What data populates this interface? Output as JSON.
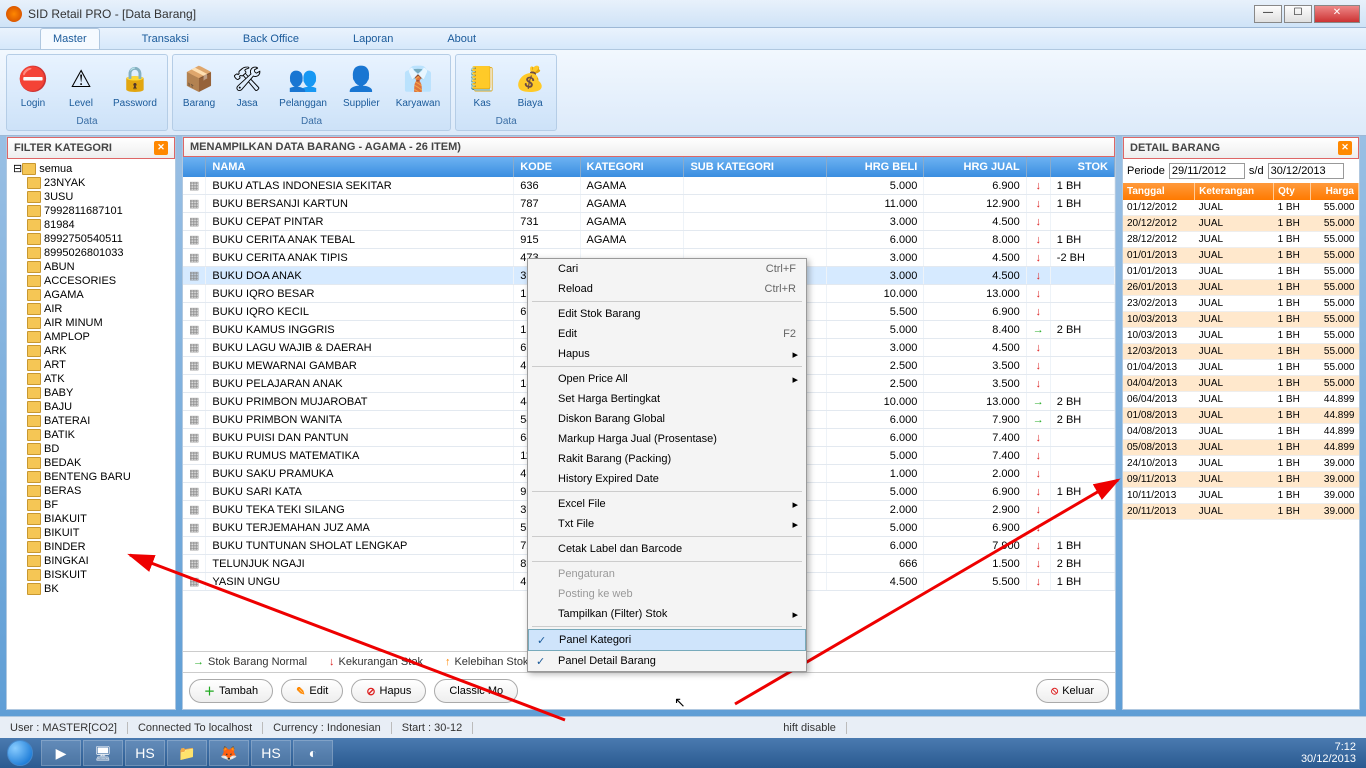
{
  "window": {
    "title": "SID Retail PRO - [Data Barang]"
  },
  "menubar": {
    "tabs": [
      "Master",
      "Transaksi",
      "Back Office",
      "Laporan",
      "About"
    ],
    "active": 0
  },
  "ribbon": {
    "groups": [
      {
        "label": "Data",
        "items": [
          {
            "t": "Login",
            "i": "⛔"
          },
          {
            "t": "Level",
            "i": "⚠"
          },
          {
            "t": "Password",
            "i": "🔒"
          }
        ]
      },
      {
        "label": "Data",
        "items": [
          {
            "t": "Barang",
            "i": "📦"
          },
          {
            "t": "Jasa",
            "i": "🛠"
          },
          {
            "t": "Pelanggan",
            "i": "👥"
          },
          {
            "t": "Supplier",
            "i": "👤"
          },
          {
            "t": "Karyawan",
            "i": "👔"
          }
        ]
      },
      {
        "label": "Data",
        "items": [
          {
            "t": "Kas",
            "i": "📒"
          },
          {
            "t": "Biaya",
            "i": "💰"
          }
        ]
      }
    ]
  },
  "filter": {
    "title": "FILTER KATEGORI",
    "root": "semua",
    "nodes": [
      "23NYAK",
      "3USU",
      "7992811687101",
      "81984",
      "8992750540511",
      "8995026801033",
      "ABUN",
      "ACCESORIES",
      "AGAMA",
      "AIR",
      "AIR MINUM",
      "AMPLOP",
      "ARK",
      "ART",
      "ATK",
      "BABY",
      "BAJU",
      "BATERAI",
      "BATIK",
      "BD",
      "BEDAK",
      "BENTENG BARU",
      "BERAS",
      "BF",
      "BIAKUIT",
      "BIKUIT",
      "BINDER",
      "BINGKAI",
      "BISKUIT",
      "BK"
    ]
  },
  "main": {
    "title": "MENAMPILKAN DATA BARANG - AGAMA -  26 ITEM)",
    "cols": [
      "NAMA",
      "KODE",
      "KATEGORI",
      "SUB KATEGORI",
      "HRG BELI",
      "HRG JUAL",
      "",
      "STOK"
    ],
    "rows": [
      {
        "n": "BUKU ATLAS INDONESIA SEKITAR",
        "k": "636",
        "c": "AGAMA",
        "hb": "5.000",
        "hj": "6.900",
        "a": "r",
        "s": "1 BH"
      },
      {
        "n": "BUKU BERSANJI KARTUN",
        "k": "787",
        "c": "AGAMA",
        "hb": "11.000",
        "hj": "12.900",
        "a": "r",
        "s": "1 BH"
      },
      {
        "n": "BUKU CEPAT PINTAR",
        "k": "731",
        "c": "AGAMA",
        "hb": "3.000",
        "hj": "4.500",
        "a": "r",
        "s": ""
      },
      {
        "n": "BUKU CERITA ANAK TEBAL",
        "k": "915",
        "c": "AGAMA",
        "hb": "6.000",
        "hj": "8.000",
        "a": "r",
        "s": "1 BH"
      },
      {
        "n": "BUKU CERITA ANAK TIPIS",
        "k": "473",
        "c": "",
        "hb": "3.000",
        "hj": "4.500",
        "a": "r",
        "s": "-2 BH"
      },
      {
        "n": "BUKU DOA ANAK",
        "k": "392",
        "c": "",
        "hb": "3.000",
        "hj": "4.500",
        "a": "r",
        "s": "",
        "sel": true
      },
      {
        "n": "BUKU IQRO BESAR",
        "k": "126",
        "c": "",
        "hb": "10.000",
        "hj": "13.000",
        "a": "r",
        "s": ""
      },
      {
        "n": "BUKU IQRO KECIL",
        "k": "679",
        "c": "",
        "hb": "5.500",
        "hj": "6.900",
        "a": "r",
        "s": ""
      },
      {
        "n": "BUKU KAMUS INGGRIS",
        "k": "159",
        "c": "",
        "hb": "5.000",
        "hj": "8.400",
        "a": "g",
        "s": "2 BH"
      },
      {
        "n": "BUKU LAGU WAJIB & DAERAH",
        "k": "617",
        "c": "",
        "hb": "3.000",
        "hj": "4.500",
        "a": "r",
        "s": ""
      },
      {
        "n": "BUKU MEWARNAI GAMBAR",
        "k": "415",
        "c": "",
        "hb": "2.500",
        "hj": "3.500",
        "a": "r",
        "s": ""
      },
      {
        "n": "BUKU PELAJARAN ANAK",
        "k": "188",
        "c": "",
        "hb": "2.500",
        "hj": "3.500",
        "a": "r",
        "s": ""
      },
      {
        "n": "BUKU PRIMBON MUJAROBAT",
        "k": "444",
        "c": "",
        "hb": "10.000",
        "hj": "13.000",
        "a": "g",
        "s": "2 BH"
      },
      {
        "n": "BUKU PRIMBON WANITA",
        "k": "545",
        "c": "",
        "hb": "6.000",
        "hj": "7.900",
        "a": "g",
        "s": "2 BH"
      },
      {
        "n": "BUKU PUISI DAN PANTUN",
        "k": "646",
        "c": "",
        "hb": "6.000",
        "hj": "7.400",
        "a": "r",
        "s": ""
      },
      {
        "n": "BUKU RUMUS MATEMATIKA",
        "k": "112",
        "c": "",
        "hb": "5.000",
        "hj": "7.400",
        "a": "r",
        "s": ""
      },
      {
        "n": "BUKU SAKU PRAMUKA",
        "k": "479",
        "c": "",
        "hb": "1.000",
        "hj": "2.000",
        "a": "r",
        "s": ""
      },
      {
        "n": "BUKU SARI KATA",
        "k": "959",
        "c": "",
        "hb": "5.000",
        "hj": "6.900",
        "a": "r",
        "s": "1 BH"
      },
      {
        "n": "BUKU TEKA TEKI SILANG",
        "k": "376",
        "c": "",
        "hb": "2.000",
        "hj": "2.900",
        "a": "r",
        "s": ""
      },
      {
        "n": "BUKU TERJEMAHAN JUZ AMA",
        "k": "554",
        "c": "",
        "hb": "5.000",
        "hj": "6.900",
        "a": "r",
        "s": ""
      },
      {
        "n": "BUKU TUNTUNAN SHOLAT LENGKAP",
        "k": "725",
        "c": "",
        "hb": "6.000",
        "hj": "7.900",
        "a": "r",
        "s": "1 BH"
      },
      {
        "n": "TELUNJUK NGAJI",
        "k": "821",
        "c": "",
        "hb": "666",
        "hj": "1.500",
        "a": "r",
        "s": "2 BH"
      },
      {
        "n": "YASIN UNGU",
        "k": "493",
        "c": "",
        "hb": "4.500",
        "hj": "5.500",
        "a": "r",
        "s": "1 BH"
      }
    ],
    "legend": {
      "normal": "Stok Barang Normal",
      "kurang": "Kekurangan Stok",
      "lebih": "Kelebihan Stok"
    },
    "buttons": {
      "tambah": "Tambah",
      "edit": "Edit",
      "hapus": "Hapus",
      "classic": "Classic Mo",
      "keluar": "Keluar"
    }
  },
  "ctx": {
    "items": [
      {
        "t": "Cari",
        "sc": "Ctrl+F"
      },
      {
        "t": "Reload",
        "sc": "Ctrl+R"
      },
      {
        "sep": true
      },
      {
        "t": "Edit Stok Barang"
      },
      {
        "t": "Edit",
        "sc": "F2"
      },
      {
        "t": "Hapus",
        "sub": true
      },
      {
        "sep": true
      },
      {
        "t": "Open Price All",
        "sub": true
      },
      {
        "t": "Set Harga Bertingkat"
      },
      {
        "t": "Diskon Barang Global"
      },
      {
        "t": "Markup Harga Jual (Prosentase)"
      },
      {
        "t": "Rakit Barang (Packing)"
      },
      {
        "t": "History Expired Date"
      },
      {
        "sep": true
      },
      {
        "t": "Excel File",
        "sub": true
      },
      {
        "t": "Txt File",
        "sub": true
      },
      {
        "sep": true
      },
      {
        "t": "Cetak Label dan Barcode"
      },
      {
        "sep": true
      },
      {
        "t": "Pengaturan",
        "dis": true
      },
      {
        "t": "Posting ke web",
        "dis": true
      },
      {
        "t": "Tampilkan (Filter) Stok",
        "sub": true
      },
      {
        "sep": true
      },
      {
        "t": "Panel Kategori",
        "chk": true,
        "hl": true
      },
      {
        "t": "Panel Detail Barang",
        "chk": true
      }
    ]
  },
  "detail": {
    "title": "DETAIL BARANG",
    "periode": {
      "lbl": "Periode",
      "from": "29/11/2012",
      "to": "30/12/2013",
      "sd": "s/d"
    },
    "cols": [
      "Tanggal",
      "Keterangan",
      "Qty",
      "Harga"
    ],
    "rows": [
      {
        "d": "01/12/2012",
        "k": "JUAL",
        "q": "1 BH",
        "h": "55.000"
      },
      {
        "d": "20/12/2012",
        "k": "JUAL",
        "q": "1 BH",
        "h": "55.000",
        "alt": true
      },
      {
        "d": "28/12/2012",
        "k": "JUAL",
        "q": "1 BH",
        "h": "55.000"
      },
      {
        "d": "01/01/2013",
        "k": "JUAL",
        "q": "1 BH",
        "h": "55.000",
        "alt": true
      },
      {
        "d": "01/01/2013",
        "k": "JUAL",
        "q": "1 BH",
        "h": "55.000"
      },
      {
        "d": "26/01/2013",
        "k": "JUAL",
        "q": "1 BH",
        "h": "55.000",
        "alt": true
      },
      {
        "d": "23/02/2013",
        "k": "JUAL",
        "q": "1 BH",
        "h": "55.000"
      },
      {
        "d": "10/03/2013",
        "k": "JUAL",
        "q": "1 BH",
        "h": "55.000",
        "alt": true
      },
      {
        "d": "10/03/2013",
        "k": "JUAL",
        "q": "1 BH",
        "h": "55.000"
      },
      {
        "d": "12/03/2013",
        "k": "JUAL",
        "q": "1 BH",
        "h": "55.000",
        "alt": true
      },
      {
        "d": "01/04/2013",
        "k": "JUAL",
        "q": "1 BH",
        "h": "55.000"
      },
      {
        "d": "04/04/2013",
        "k": "JUAL",
        "q": "1 BH",
        "h": "55.000",
        "alt": true
      },
      {
        "d": "06/04/2013",
        "k": "JUAL",
        "q": "1 BH",
        "h": "44.899"
      },
      {
        "d": "01/08/2013",
        "k": "JUAL",
        "q": "1 BH",
        "h": "44.899",
        "alt": true
      },
      {
        "d": "04/08/2013",
        "k": "JUAL",
        "q": "1 BH",
        "h": "44.899"
      },
      {
        "d": "05/08/2013",
        "k": "JUAL",
        "q": "1 BH",
        "h": "44.899",
        "alt": true
      },
      {
        "d": "24/10/2013",
        "k": "JUAL",
        "q": "1 BH",
        "h": "39.000"
      },
      {
        "d": "09/11/2013",
        "k": "JUAL",
        "q": "1 BH",
        "h": "39.000",
        "alt": true
      },
      {
        "d": "10/11/2013",
        "k": "JUAL",
        "q": "1 BH",
        "h": "39.000"
      },
      {
        "d": "20/11/2013",
        "k": "JUAL",
        "q": "1 BH",
        "h": "39.000",
        "alt": true
      }
    ]
  },
  "status": {
    "user": "User : MASTER[CO2]",
    "conn": "Connected To localhost",
    "curr": "Currency : Indonesian",
    "start": "Start : 30-12",
    "shift": "hift disable"
  },
  "tray": {
    "time": "7:12",
    "date": "30/12/2013"
  }
}
